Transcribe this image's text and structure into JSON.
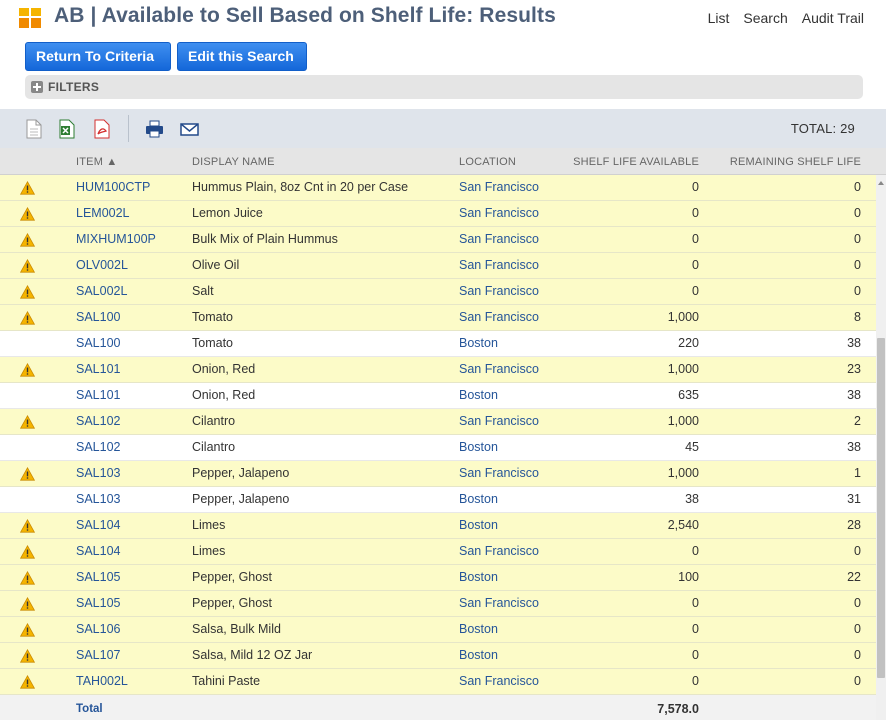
{
  "header": {
    "title": "AB | Available to Sell Based on Shelf Life: Results",
    "links": [
      "List",
      "Search",
      "Audit Trail"
    ]
  },
  "buttons": {
    "return_label": "Return To Criteria",
    "edit_label": "Edit this Search"
  },
  "filters": {
    "label": "FILTERS"
  },
  "toolbar": {
    "total_label": "TOTAL: 29"
  },
  "columns": {
    "item": "ITEM ▲",
    "display_name": "DISPLAY NAME",
    "location": "LOCATION",
    "shelf_life_available": "SHELF LIFE AVAILABLE",
    "remaining_shelf_life": "REMAINING SHELF LIFE"
  },
  "rows": [
    {
      "warn": true,
      "item": "HUM100CTP",
      "name": "Hummus Plain, 8oz Cnt in 20 per Case",
      "loc": "San Francisco",
      "sla": "0",
      "rsl": "0"
    },
    {
      "warn": true,
      "item": "LEM002L",
      "name": "Lemon Juice",
      "loc": "San Francisco",
      "sla": "0",
      "rsl": "0"
    },
    {
      "warn": true,
      "item": "MIXHUM100P",
      "name": "Bulk Mix of Plain Hummus",
      "loc": "San Francisco",
      "sla": "0",
      "rsl": "0"
    },
    {
      "warn": true,
      "item": "OLV002L",
      "name": "Olive Oil",
      "loc": "San Francisco",
      "sla": "0",
      "rsl": "0"
    },
    {
      "warn": true,
      "item": "SAL002L",
      "name": "Salt",
      "loc": "San Francisco",
      "sla": "0",
      "rsl": "0"
    },
    {
      "warn": true,
      "item": "SAL100",
      "name": "Tomato",
      "loc": "San Francisco",
      "sla": "1,000",
      "rsl": "8"
    },
    {
      "warn": false,
      "item": "SAL100",
      "name": "Tomato",
      "loc": "Boston",
      "sla": "220",
      "rsl": "38"
    },
    {
      "warn": true,
      "item": "SAL101",
      "name": "Onion, Red",
      "loc": "San Francisco",
      "sla": "1,000",
      "rsl": "23"
    },
    {
      "warn": false,
      "item": "SAL101",
      "name": "Onion, Red",
      "loc": "Boston",
      "sla": "635",
      "rsl": "38"
    },
    {
      "warn": true,
      "item": "SAL102",
      "name": "Cilantro",
      "loc": "San Francisco",
      "sla": "1,000",
      "rsl": "2"
    },
    {
      "warn": false,
      "item": "SAL102",
      "name": "Cilantro",
      "loc": "Boston",
      "sla": "45",
      "rsl": "38"
    },
    {
      "warn": true,
      "item": "SAL103",
      "name": "Pepper, Jalapeno",
      "loc": "San Francisco",
      "sla": "1,000",
      "rsl": "1"
    },
    {
      "warn": false,
      "item": "SAL103",
      "name": "Pepper, Jalapeno",
      "loc": "Boston",
      "sla": "38",
      "rsl": "31"
    },
    {
      "warn": true,
      "item": "SAL104",
      "name": "Limes",
      "loc": "Boston",
      "sla": "2,540",
      "rsl": "28"
    },
    {
      "warn": true,
      "item": "SAL104",
      "name": "Limes",
      "loc": "San Francisco",
      "sla": "0",
      "rsl": "0"
    },
    {
      "warn": true,
      "item": "SAL105",
      "name": "Pepper, Ghost",
      "loc": "Boston",
      "sla": "100",
      "rsl": "22"
    },
    {
      "warn": true,
      "item": "SAL105",
      "name": "Pepper, Ghost",
      "loc": "San Francisco",
      "sla": "0",
      "rsl": "0"
    },
    {
      "warn": true,
      "item": "SAL106",
      "name": "Salsa, Bulk Mild",
      "loc": "Boston",
      "sla": "0",
      "rsl": "0"
    },
    {
      "warn": true,
      "item": "SAL107",
      "name": "Salsa, Mild 12 OZ Jar",
      "loc": "Boston",
      "sla": "0",
      "rsl": "0"
    },
    {
      "warn": true,
      "item": "TAH002L",
      "name": "Tahini Paste",
      "loc": "San Francisco",
      "sla": "0",
      "rsl": "0"
    }
  ],
  "total_row": {
    "label": "Total",
    "sla": "7,578.0"
  },
  "icons": {
    "app": "app-grid-icon",
    "toolbar": [
      "csv-file-icon",
      "excel-icon",
      "pdf-icon",
      "print-icon",
      "email-icon"
    ],
    "row_warning": "warning-icon"
  },
  "colors": {
    "title": "#4d5f79",
    "button": "#1467d9",
    "link": "#255599",
    "warn_row": "#fcfbc8",
    "toolbar_bg": "#dfe4eb"
  }
}
